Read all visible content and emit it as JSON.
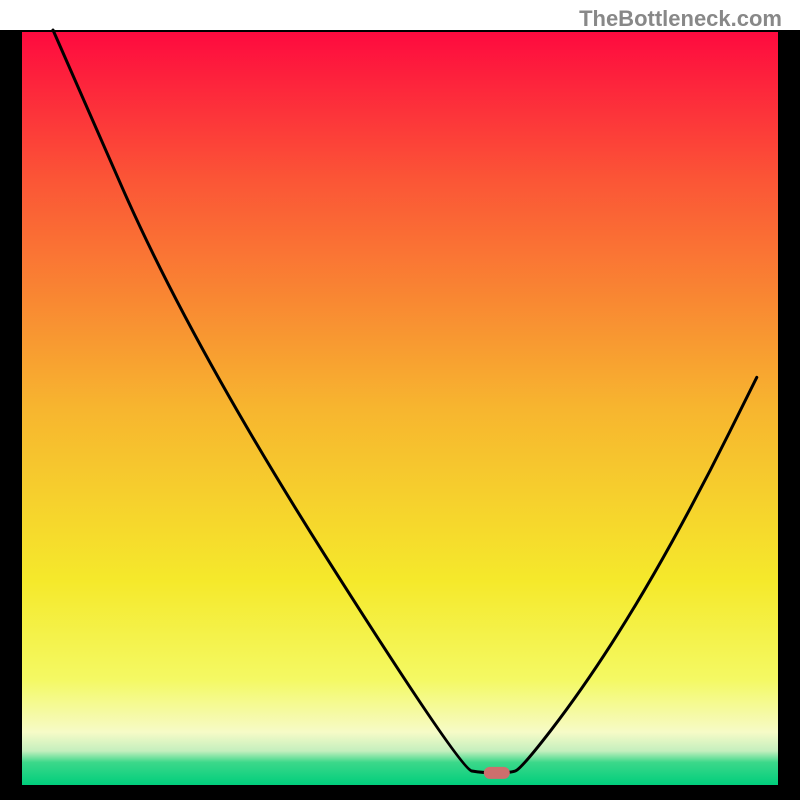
{
  "watermark": "TheBottleneck.com",
  "chart_data": {
    "type": "line",
    "title": "",
    "xlabel": "",
    "ylabel": "",
    "xlim": [
      0,
      100
    ],
    "ylim": [
      0,
      100
    ],
    "curve_points": [
      {
        "x": 4.1,
        "y": 100
      },
      {
        "x": 22.3,
        "y": 58.5
      },
      {
        "x": 58.0,
        "y": 2.1
      },
      {
        "x": 61.0,
        "y": 1.6
      },
      {
        "x": 64.5,
        "y": 1.6
      },
      {
        "x": 66.0,
        "y": 2.1
      },
      {
        "x": 74.0,
        "y": 12.5
      },
      {
        "x": 82.0,
        "y": 25.0
      },
      {
        "x": 90.0,
        "y": 39.5
      },
      {
        "x": 97.2,
        "y": 54.0
      }
    ],
    "marker": {
      "x": 62.8,
      "y": 1.6
    },
    "background_gradient_stops": [
      {
        "offset": 0.0,
        "color": "#fe093f"
      },
      {
        "offset": 0.2,
        "color": "#fb5636"
      },
      {
        "offset": 0.5,
        "color": "#f7b52f"
      },
      {
        "offset": 0.73,
        "color": "#f5e92b"
      },
      {
        "offset": 0.86,
        "color": "#f4f963"
      },
      {
        "offset": 0.93,
        "color": "#f6fbc7"
      },
      {
        "offset": 0.955,
        "color": "#c4efbe"
      },
      {
        "offset": 0.97,
        "color": "#3cd88a"
      },
      {
        "offset": 1.0,
        "color": "#00ce7c"
      }
    ],
    "border_color": "#000000",
    "curve_color": "#000000",
    "marker_color": "#cd6f6d"
  }
}
